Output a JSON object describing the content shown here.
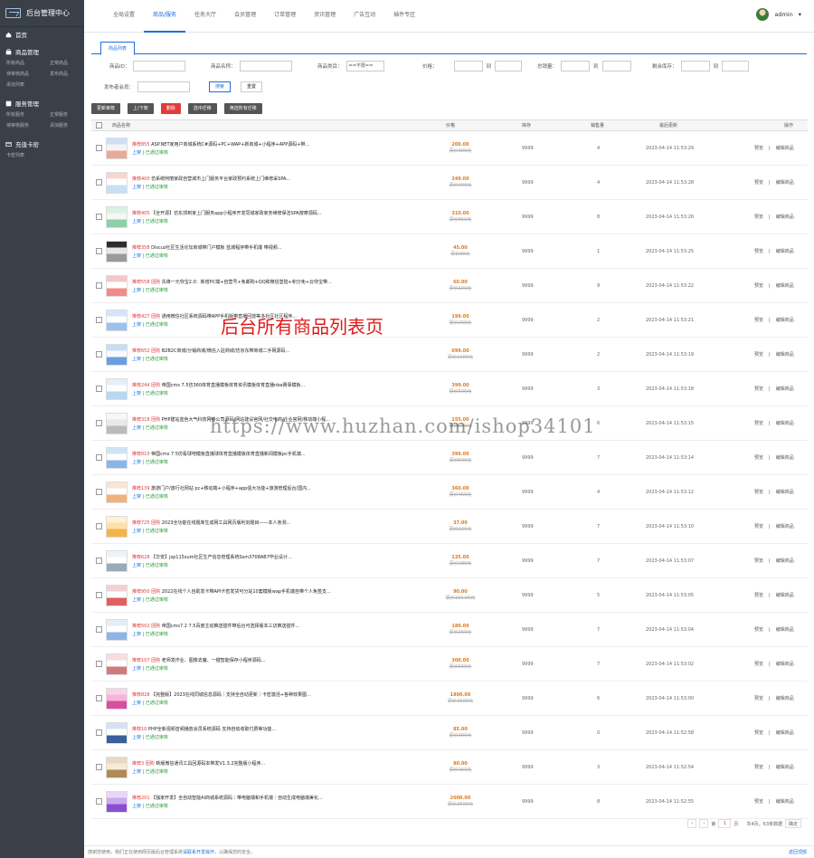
{
  "app": {
    "title": "后台管理中心"
  },
  "sidebar": {
    "home": "首页",
    "groups": [
      {
        "title": "商品管理",
        "items": [
          "所有商品",
          "正常商品",
          "待审核商品",
          "发布商品",
          "添加列表"
        ]
      },
      {
        "title": "服务管理",
        "items": [
          "所有服务",
          "正常服务",
          "待审核服务",
          "添加服务"
        ]
      },
      {
        "title": "充值卡密",
        "items": [
          "卡密列表"
        ]
      }
    ]
  },
  "topnav": {
    "items": [
      "全局设置",
      "商品/服务",
      "任务大厅",
      "会员管理",
      "订单管理",
      "资讯管理",
      "广告互动",
      "插件专区"
    ],
    "active_index": 1,
    "user": "admin"
  },
  "tab": {
    "label": "商品列表"
  },
  "filter": {
    "id_label": "商品ID：",
    "title_label": "商品名称：",
    "category_label": "商品类目：",
    "category_value": "==不限==",
    "price_label": "价格：",
    "sold_label": "总销量：",
    "stock_label": "剩余库存：",
    "to": "到",
    "seller_label": "发布者会员：",
    "search_btn": "搜索",
    "reset_btn": "重置"
  },
  "actions": [
    "更新审核",
    "上/下架",
    "删除",
    "选中迁移",
    "筛选所有迁移"
  ],
  "table": {
    "headers": {
      "name": "商品名称",
      "price": "价格",
      "stock": "库存",
      "sold": "销售量",
      "date": "最后更新",
      "op": "操作"
    },
    "op_view": "预览",
    "op_edit": "编辑商品",
    "status_on": "上架",
    "status_sep": " | ",
    "status_ok": "已通过审核",
    "date": "2023-04-14 11:53:",
    "rows": [
      {
        "cat": "推荐855",
        "title": "ASP.NET家用户商城系统C#源码+PC+WAP+新商城+小程序+APP源码+带...",
        "price": "200.00",
        "old": "原价300元",
        "stock": "9999",
        "sold": "4",
        "sec": "29"
      },
      {
        "cat": "推荐400",
        "title": "仿系统阿丽家政自营城市上门服务平台家政预约系统上门维修采SPA...",
        "price": "249.00",
        "old": "原价400元",
        "stock": "9999",
        "sold": "4",
        "sec": "28"
      },
      {
        "cat": "推荐405",
        "title": "【全开源】仿东郊到家上门服务app小程序开发同城家政家务维修保洁SPA按摩源码...",
        "price": "310.00",
        "old": "原价650元",
        "stock": "9999",
        "sold": "8",
        "sec": "26"
      },
      {
        "cat": "推荐358",
        "title": "Discuz社区生活论坛商城带门户模板 蓝城程序带手机端 带视频...",
        "price": "45.00",
        "old": "原价90元",
        "stock": "9999",
        "sold": "1",
        "sec": "25"
      },
      {
        "cat": "推荐558 团购",
        "title": "先锋一元夺宝2.0：新增PC端+自营号+免邮购+QQ和微信登陆+积分免+云夺宝带...",
        "price": "60.00",
        "old": "原价100元",
        "stock": "9999",
        "sold": "9",
        "sec": "22"
      },
      {
        "cat": "推荐427 团购",
        "title": "通用微信社区系统源码带APP手机版带直播回放等多社区社区程序...",
        "price": "199.00",
        "old": "原价299元",
        "stock": "9999",
        "sold": "2",
        "sec": "21"
      },
      {
        "cat": "推荐652 团购",
        "title": "B2B2C商城/分销商城/微信入驻商城/仿京东带商城二手网源码...",
        "price": "699.00",
        "old": "原价1000元",
        "stock": "9999",
        "sold": "2",
        "sec": "19"
      },
      {
        "cat": "推荐244 团购",
        "title": "帝国cms 7.5仿360体育直播模板体育资讯模板体育直播nba赛事模板...",
        "price": "399.00",
        "old": "原价500元",
        "stock": "9999",
        "sold": "3",
        "sec": "18"
      },
      {
        "cat": "推荐318 团购",
        "title": "PHP建站蓝色大气科技网络公司源码/网站建设官网/社交电商/企业官网/移动端小程...",
        "price": "155.00",
        "old": "原价200元",
        "stock": "9999",
        "sold": "6",
        "sec": "15"
      },
      {
        "cat": "推荐810",
        "title": "帝国cms 7.5仿看球吧模板直播球体育直播模板体育直播新闻模板pc手机端...",
        "price": "399.00",
        "old": "原价500元",
        "stock": "9999",
        "sold": "7",
        "sec": "14"
      },
      {
        "cat": "推荐139",
        "title": "旅游门户/旅行社网站 pc+移动端+小程序+app强大功能+旅游管理后台/国内...",
        "price": "360.00",
        "old": "原价460元",
        "stock": "9999",
        "sold": "4",
        "sec": "12"
      },
      {
        "cat": "推荐725 团购",
        "title": "2023全功能在线题库生成网工具网页版利剑题目——本人亲测...",
        "price": "37.00",
        "old": "原价220元",
        "stock": "9999",
        "sold": "7",
        "sec": "10"
      },
      {
        "cat": "推荐628",
        "title": "【华安】jsp115sum社区生产信息管理系统Ssm3708AB7毕业设计...",
        "price": "135.00",
        "old": "原价180元",
        "stock": "9999",
        "sold": "7",
        "sec": "07"
      },
      {
        "cat": "推荐950 团购",
        "title": "2022在线个人自助发卡带API卡密发货可分站10套模板wap手机端自带个人免签支...",
        "price": "90.00",
        "old": "原价150.00元",
        "stock": "9999",
        "sold": "5",
        "sec": "05"
      },
      {
        "cat": "推荐502 团购",
        "title": "帝国cms7.2 7.5百度主动推送插件带后台可选择版本三访推送插件...",
        "price": "180.00",
        "old": "原价260元",
        "stock": "9999",
        "sold": "7",
        "sec": "04"
      },
      {
        "cat": "推荐107 团购",
        "title": "老师发作业、图像去魔、一键智能保存小程序源码...",
        "price": "300.00",
        "old": "原价560元",
        "stock": "9999",
        "sold": "7",
        "sec": "02"
      },
      {
        "cat": "推荐828",
        "title": "【完整版】2023在线同城信息源码｜支持全自动更新｜卡密激活+各种效果图...",
        "price": "1800.00",
        "old": "原价2500元",
        "stock": "9999",
        "sold": "6",
        "sec": "00"
      },
      {
        "cat": "推荐10",
        "title": "PHP全新视频音频播放会员系统源码 支持自动收取付费等功能...",
        "price": "85.00",
        "old": "原价200元",
        "stock": "9999",
        "sold": "0",
        "sec": "58",
        "minute": "52"
      },
      {
        "cat": "推荐3 团购",
        "title": "新版微信通讯工具回源码本带发V1.3.2完整版小程序...",
        "price": "80.00",
        "old": "原价150元",
        "stock": "9999",
        "sold": "3",
        "sec": "54",
        "minute": "52"
      },
      {
        "cat": "推荐201",
        "title": "【独家开发】全自动智能AI商城系统源码｜带电脑端和手机端｜自动生成电脑端美化...",
        "price": "2000.00",
        "old": "原价2500元",
        "stock": "9999",
        "sold": "8",
        "sec": "55",
        "minute": "52"
      }
    ]
  },
  "overlay": {
    "title": "后台所有商品列表页",
    "watermark": "https://www.huzhan.com/ishop34101"
  },
  "pager": {
    "page": "1",
    "page_prefix": "第",
    "page_suffix": "页",
    "total": "共4页，63条数据",
    "go": "确定"
  },
  "footer": {
    "text": "感谢您使用，我们正在使用网页版后台管理系统",
    "link": "请联系开发操作",
    "tail": "，以确保您的安全。",
    "right": "返回顶部"
  }
}
